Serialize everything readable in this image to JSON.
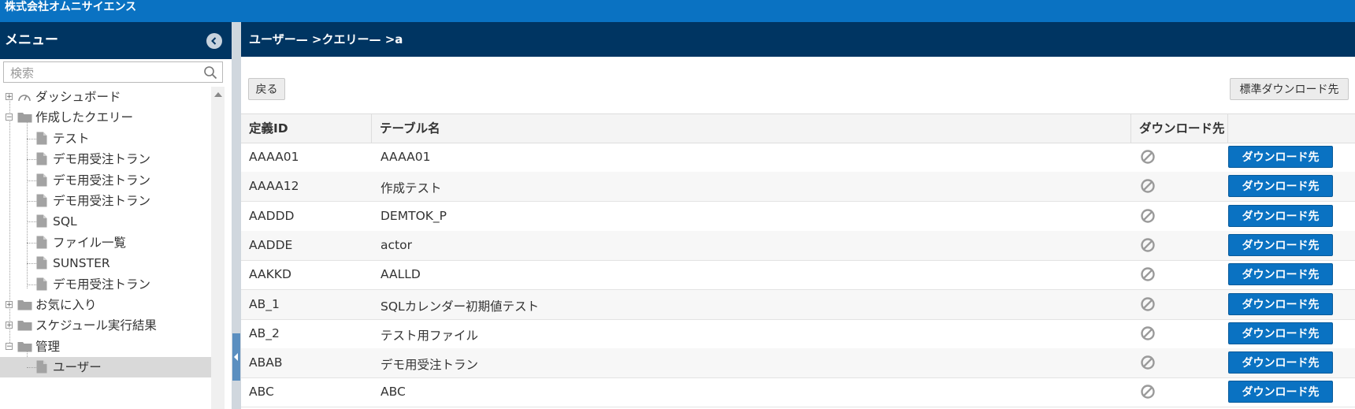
{
  "app": {
    "company_name": "株式会社オムニサイエンス"
  },
  "sidebar": {
    "title": "メニュー",
    "search_placeholder": "検索",
    "tree": [
      {
        "label": "ダッシュボード",
        "level": 0,
        "type": "dashboard",
        "expander": "+"
      },
      {
        "label": "作成したクエリー",
        "level": 0,
        "type": "folder-open",
        "expander": "−"
      },
      {
        "label": "テスト",
        "level": 1,
        "type": "file"
      },
      {
        "label": "デモ用受注トラン",
        "level": 1,
        "type": "file"
      },
      {
        "label": "デモ用受注トラン",
        "level": 1,
        "type": "file"
      },
      {
        "label": "デモ用受注トラン",
        "level": 1,
        "type": "file"
      },
      {
        "label": "SQL",
        "level": 1,
        "type": "file"
      },
      {
        "label": "ファイル一覧",
        "level": 1,
        "type": "file"
      },
      {
        "label": "SUNSTER",
        "level": 1,
        "type": "file"
      },
      {
        "label": "デモ用受注トラン",
        "level": 1,
        "type": "file"
      },
      {
        "label": "お気に入り",
        "level": 0,
        "type": "folder",
        "expander": "+"
      },
      {
        "label": "スケジュール実行結果",
        "level": 0,
        "type": "folder",
        "expander": "+"
      },
      {
        "label": "管理",
        "level": 0,
        "type": "folder-open",
        "expander": "−"
      },
      {
        "label": "ユーザー",
        "level": 1,
        "type": "file",
        "selected": true
      }
    ]
  },
  "main": {
    "breadcrumb": "ユーザー— >クエリー— >a",
    "back_button": "戻る",
    "default_download_button": "標準ダウンロード先",
    "columns": [
      "定義ID",
      "テーブル名",
      "ダウンロード先",
      ""
    ],
    "download_button_label": "ダウンロード先",
    "rows": [
      {
        "id": "AAAA01",
        "table": "AAAA01"
      },
      {
        "id": "AAAA12",
        "table": "作成テスト"
      },
      {
        "id": "AADDD",
        "table": "DEMTOK_P"
      },
      {
        "id": "AADDE",
        "table": "actor"
      },
      {
        "id": "AAKKD",
        "table": "AALLD"
      },
      {
        "id": "AB_1",
        "table": "SQLカレンダー初期値テスト"
      },
      {
        "id": "AB_2",
        "table": "テスト用ファイル"
      },
      {
        "id": "ABAB",
        "table": "デモ用受注トラン"
      },
      {
        "id": "ABC",
        "table": "ABC"
      }
    ]
  },
  "colors": {
    "company_bar": "#0a72c2",
    "header_navy": "#003562",
    "button_blue": "#0a72c2"
  },
  "icons": {
    "collapse": "chevron-left-circle-icon",
    "search": "search-icon",
    "dashboard": "gauge-icon",
    "folder": "folder-icon",
    "file": "document-icon",
    "download_status": "ban-icon"
  }
}
